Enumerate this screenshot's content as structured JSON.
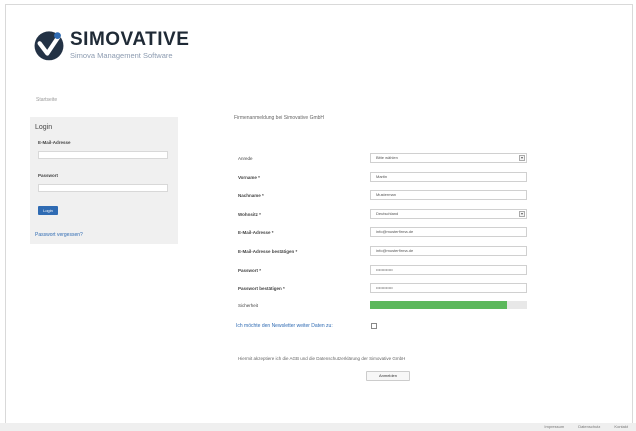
{
  "brand": {
    "name": "SIMOVATIVE",
    "subtitle": "Simova Management Software",
    "accent": "#2f6bb3",
    "logo_icon": "simovative-logo-icon"
  },
  "breadcrumb": "Startseite",
  "login": {
    "title": "Login",
    "email_label": "E-Mail-Adresse",
    "email_value": "",
    "password_label": "Passwort",
    "password_value": "",
    "submit_label": "Login",
    "forgot_link": "Passwort vergessen?"
  },
  "registration": {
    "title": "Firmenanmeldung bei Simovative GmbH",
    "fields": [
      {
        "label": "Anrede",
        "value": "Bitte wählen",
        "type": "select",
        "bold": false
      },
      {
        "label": "Vorname *",
        "value": "Martin",
        "type": "text",
        "bold": true
      },
      {
        "label": "Nachname *",
        "value": "Musterman",
        "type": "text",
        "bold": true
      },
      {
        "label": "Wohnsitz *",
        "value": "Deutschland",
        "type": "select",
        "bold": true
      },
      {
        "label": "E-Mail-Adresse *",
        "value": "info@musterfirma.de",
        "type": "text",
        "bold": true
      },
      {
        "label": "E-Mail-Adresse bestätigen *",
        "value": "info@musterfirma.de",
        "type": "text",
        "bold": true
      },
      {
        "label": "Passwort *",
        "value": "••••••••••••",
        "type": "password",
        "bold": true
      },
      {
        "label": "Passwort bestätigen *",
        "value": "••••••••••••",
        "type": "password",
        "bold": true
      }
    ],
    "strength_label": "Sicherheit",
    "strength_level": 0.87,
    "strength_color": "#5cb85c",
    "newsletter_label": "Ich möchte den Newsletter weiter Daten zu:",
    "newsletter_checked": false,
    "agb_text": "Hiermit akzeptiere ich die AGB und die Datenschutzerklärung der Simovative GmbH",
    "submit_label": "Anmelden"
  },
  "footer": {
    "links": [
      "Impressum",
      "Datenschutz",
      "Kontakt"
    ]
  }
}
